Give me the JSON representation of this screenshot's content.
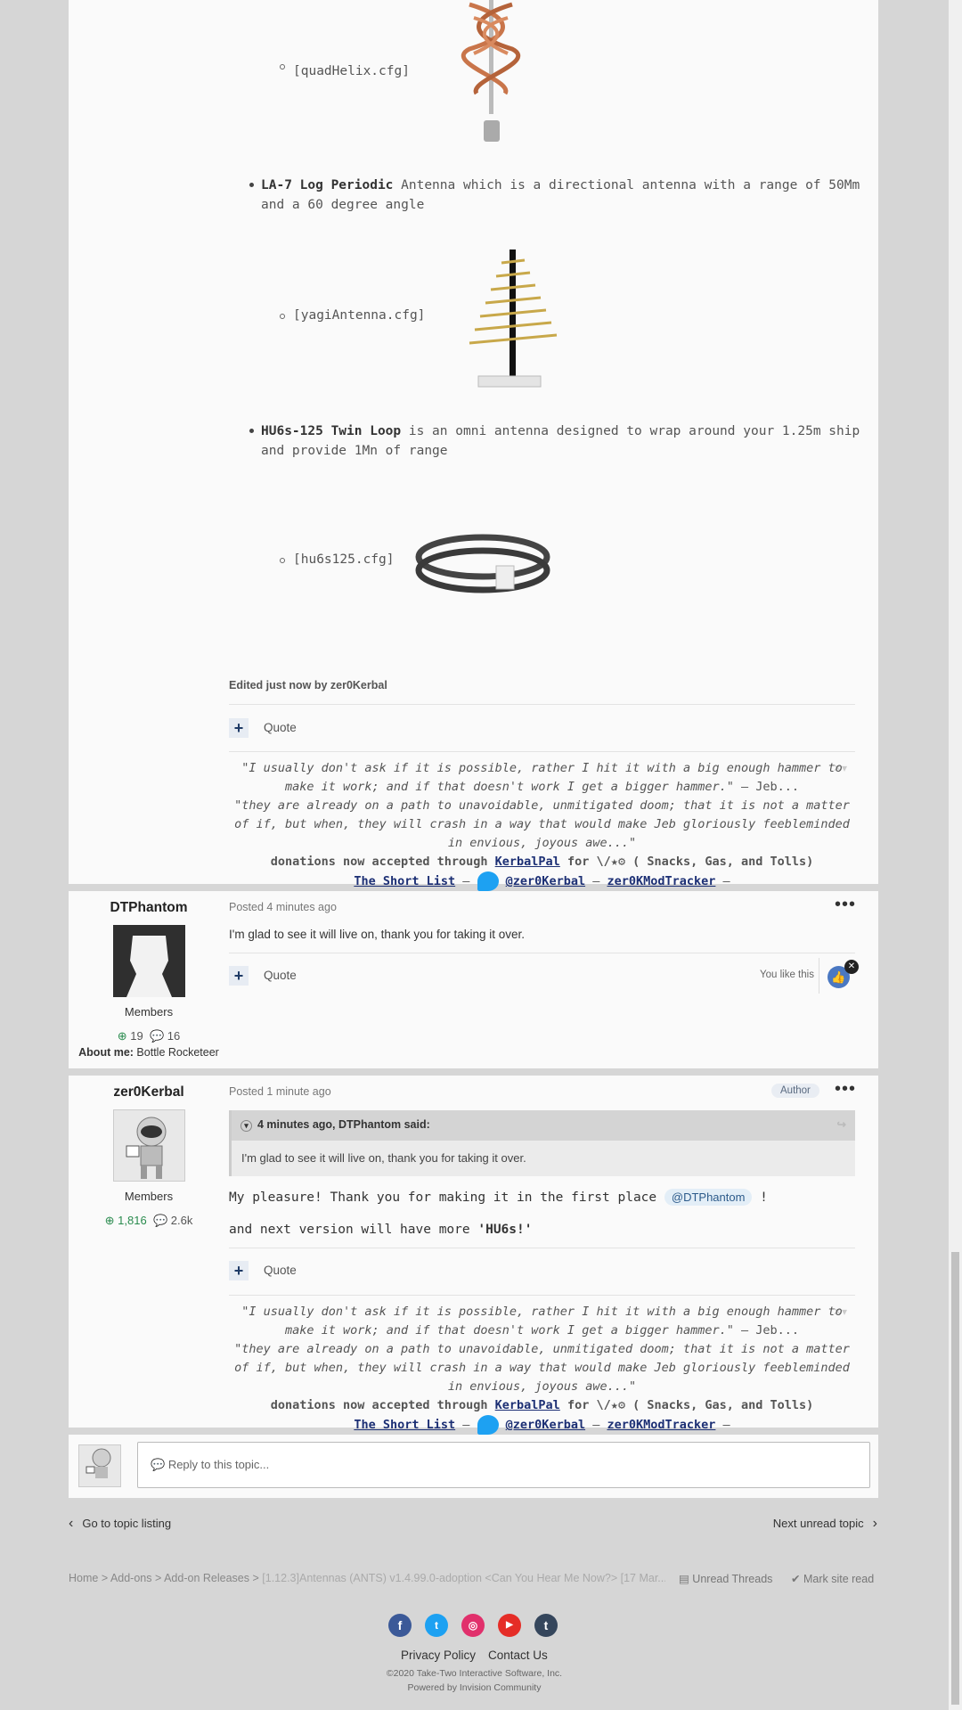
{
  "post1": {
    "items": [
      {
        "file": "[quadHelix.cfg]"
      },
      {
        "name": "LA-7 Log Periodic",
        "desc": " Antenna which is a directional antenna with a range of 50Mm and a 60 degree angle",
        "file": "[yagiAntenna.cfg]"
      },
      {
        "name": "HU6s-125 Twin Loop",
        "desc": " is an omni antenna designed to wrap around your 1.25m ship and provide 1Mn of range",
        "file": "[hu6s125.cfg]"
      }
    ],
    "edited": "Edited just now by zer0Kerbal",
    "quote_label": "Quote"
  },
  "signature": {
    "line1": "\"I usually don't ask if it is possible, rather I hit it with a big enough hammer to make it work; and if that doesn't work I get a bigger hammer.\"",
    "line1_attr": " — Jeb...",
    "line2": "\"they are already on a path to unavoidable, unmitigated doom; that it is not a matter of if, but when, they will crash in a way that would make Jeb gloriously feebleminded in envious, joyous awe...\"",
    "donations_pre": "donations now accepted through ",
    "kerbalpal": "KerbalPal",
    "donations_for": " for ",
    "donations_post": " ( Snacks, Gas, and Tolls)",
    "short_list": "The Short List",
    "dash1": " — ",
    "twitter": "@zer0Kerbal",
    "dash2": " — ",
    "tracker": "zer0KModTracker",
    "dash3": " —"
  },
  "post2": {
    "username": "DTPhantom",
    "role": "Members",
    "rep": "19",
    "posts": "16",
    "about_label": "About me:",
    "about_value": " Bottle Rocketeer",
    "posted": "Posted 4 minutes ago",
    "body": "I'm glad to see it will live on, thank you for taking it over.",
    "quote_label": "Quote",
    "you_like": "You like this"
  },
  "post3": {
    "username": "zer0Kerbal",
    "role": "Members",
    "rep": "1,816",
    "posts": "2.6k",
    "posted": "Posted 1 minute ago",
    "author_badge": "Author",
    "quote_header": "4 minutes ago, DTPhantom said:",
    "quote_body": "I'm glad to see it will live on, thank you for taking it over.",
    "body1_pre": "My pleasure! Thank you for making it in the first place ",
    "mention": "@DTPhantom",
    "body1_post": " !",
    "body2_pre": "and next version will have more ",
    "body2_bold": "'HU6s!'",
    "quote_label": "Quote"
  },
  "reply": {
    "placeholder": "Reply to this topic..."
  },
  "nav": {
    "prev": "Go to topic listing",
    "next": "Next unread topic"
  },
  "breadcrumb": {
    "items": [
      "Home",
      "Add-ons",
      "Add-on Releases",
      "[1.12.3]Antennas (ANTS) v1.4.99.0-adoption <Can You Hear Me Now?> [17 Mar..."
    ],
    "sep": ">",
    "unread": "Unread Threads",
    "mark_read": "Mark site read"
  },
  "footer": {
    "privacy": "Privacy Policy",
    "contact": "Contact Us",
    "copyright": "©2020 Take-Two Interactive Software, Inc.",
    "powered": "Powered by Invision Community"
  },
  "colors": {
    "accent": "#1c2f74",
    "rep_green": "#2a8b4e",
    "twitter": "#1da1f2",
    "facebook": "#3b5998",
    "instagram": "#e1306c",
    "youtube": "#e52d27",
    "tumblr": "#35465c"
  }
}
